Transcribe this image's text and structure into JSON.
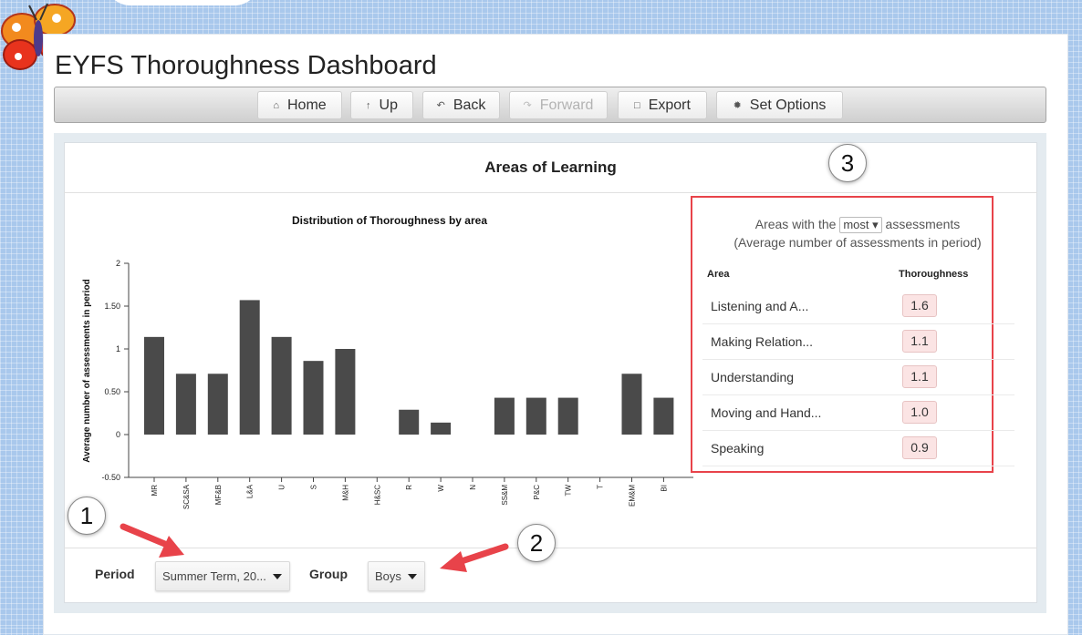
{
  "app": {
    "title": "EYFS Thoroughness Dashboard"
  },
  "nav": {
    "buttons": [
      {
        "label": "Home",
        "icon": "home-icon",
        "enabled": true
      },
      {
        "label": "Up",
        "icon": "up-arrow-icon",
        "enabled": true
      },
      {
        "label": "Back",
        "icon": "back-arrow-icon",
        "enabled": true
      },
      {
        "label": "Forward",
        "icon": "forward-arrow-icon",
        "enabled": false
      },
      {
        "label": "Export",
        "icon": "document-icon",
        "enabled": true
      },
      {
        "label": "Set Options",
        "icon": "gear-icon",
        "enabled": true
      }
    ]
  },
  "card": {
    "title": "Areas of Learning"
  },
  "chart_data": {
    "type": "bar",
    "title": "Distribution of Thoroughness by area",
    "xlabel": "",
    "ylabel": "Average number of assessments in period",
    "categories": [
      "MR",
      "SC&SA",
      "MF&B",
      "L&A",
      "U",
      "S",
      "M&H",
      "H&SC",
      "R",
      "W",
      "N",
      "SS&M",
      "P&C",
      "TW",
      "T",
      "EM&M",
      "BI"
    ],
    "values": [
      1.14,
      0.71,
      0.71,
      1.57,
      1.14,
      0.86,
      1.0,
      0.0,
      0.29,
      0.14,
      0.0,
      0.43,
      0.43,
      0.43,
      0.0,
      0.71,
      0.43
    ],
    "ylim": [
      -0.5,
      2
    ],
    "yticks": [
      -0.5,
      0,
      0.5,
      1,
      1.5,
      2
    ],
    "ytick_labels": [
      "-0.50",
      "0",
      "0.50",
      "1",
      "1.50",
      "2"
    ],
    "bar_color": "#4a4a4a",
    "grid": false
  },
  "summary": {
    "prefix": "Areas with the",
    "select_value": "most",
    "suffix": "assessments",
    "subtitle": "(Average number of assessments in period)",
    "col_area": "Area",
    "col_value": "Thoroughness",
    "rows": [
      {
        "area": "Listening and A...",
        "value": "1.6"
      },
      {
        "area": "Making Relation...",
        "value": "1.1"
      },
      {
        "area": "Understanding",
        "value": "1.1"
      },
      {
        "area": "Moving and Hand...",
        "value": "1.0"
      },
      {
        "area": "Speaking",
        "value": "0.9"
      }
    ]
  },
  "filters": {
    "period_label": "Period",
    "period_value": "Summer Term, 20...",
    "group_label": "Group",
    "group_value": "Boys"
  },
  "callouts": [
    "1",
    "2",
    "3"
  ],
  "colors": {
    "highlight_border": "#e8434a",
    "arrow": "#e8434a",
    "value_badge": "#fbe4e4"
  }
}
